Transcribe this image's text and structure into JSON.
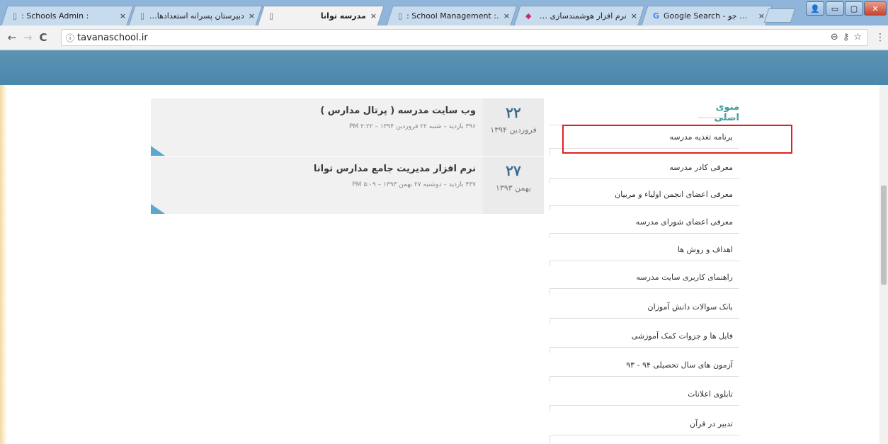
{
  "browser": {
    "tabs": [
      {
        "title": ": Schools Admin :",
        "favicon": "page-icon"
      },
      {
        "title": "دبیرستان پسرانه استعدادهای درخ",
        "favicon": "page-icon"
      },
      {
        "title": "",
        "favicon": "page-icon"
      },
      {
        "title": "مدرسه توانا",
        "favicon": "none"
      },
      {
        "title": ": School Management :.",
        "favicon": "page-icon"
      },
      {
        "title": "نرم افزار هوشمندسازی مدارس",
        "favicon": "app-icon"
      },
      {
        "title": "Google Search - سوپ جو",
        "favicon": "google-icon"
      }
    ],
    "tab_close": "×",
    "url": "tavanaschool.ir",
    "info_icon": "ⓘ",
    "back": "←",
    "forward": "→",
    "reload": "C",
    "zoom_icon": "⊖",
    "key_icon": "⚷",
    "star_icon": "☆",
    "menu_icon": "⋮",
    "window_controls": {
      "user": "👤",
      "minimize": "▭",
      "maximize": "▢",
      "close": "✕"
    }
  },
  "posts": [
    {
      "day": "۲۲",
      "month": "فروردین ۱۳۹۴",
      "title": "وب سایت مدرسه ( پرتال مدارس )",
      "meta": "۳۹۶ بازدید – شنبه ۲۲ فروردین ۱۳۹۴ – ۲:۲۲ PM"
    },
    {
      "day": "۲۷",
      "month": "بهمن ۱۳۹۳",
      "title": "نرم افزار مدیریت جامع مدارس توانا",
      "meta": "۴۳۷ بازدید – دوشنبه ۲۷ بهمن ۱۳۹۳ – ۵:۰۹ PM"
    }
  ],
  "main_menu": {
    "heading": "منوی اصلی",
    "items": [
      "برنامه تغذیه مدرسه",
      "معرفی کادر مدرسه",
      "معرفی اعضای انجمن اولیاء و مربیان",
      "معرفی اعضای شورای مدرسه",
      "اهداف و روش ها",
      "راهنمای کاربری سایت مدرسه",
      "بانک سوالات دانش آموزان",
      "فایل ها و جزوات کمک آموزشی",
      "آزمون های سال تحصیلی ۹۴ - ۹۳",
      "تابلوی اعلانات",
      "تدبیر در قرآن"
    ],
    "highlight_color": "#e02020"
  }
}
